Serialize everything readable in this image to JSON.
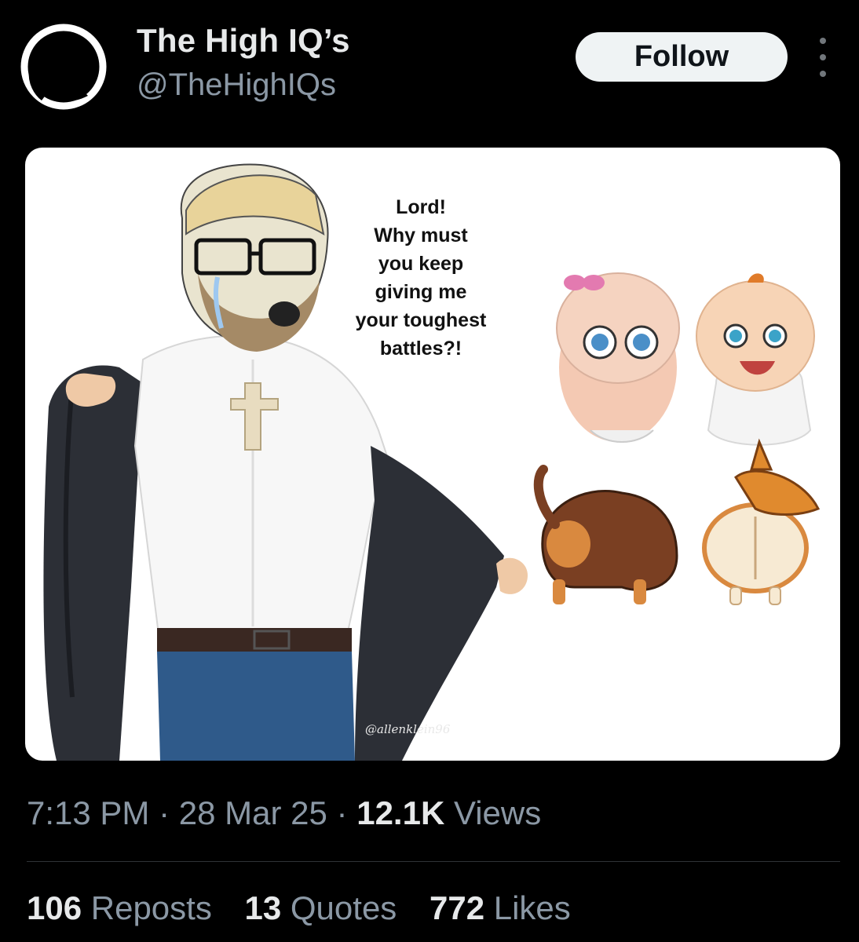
{
  "account": {
    "display_name": "The High IQ’s",
    "handle": "@TheHighIQs",
    "avatar_icon": "black-silhouette-avatar"
  },
  "actions": {
    "follow_label": "Follow",
    "more_icon": "vertical-ellipsis-icon"
  },
  "media": {
    "speech_text": "Lord!\nWhy must\nyou keep\ngiving me\nyour toughest\nbattles?!",
    "speech_lines": [
      "Lord!",
      "Why must",
      "you keep",
      "giving me",
      "your toughest",
      "battles?!"
    ],
    "watermark": "@allenklein96",
    "figures": [
      "bearded-man-crying-opening-jacket",
      "baby-girl-with-bow",
      "baby-boy",
      "dachshund-from-behind",
      "corgi-from-behind"
    ]
  },
  "meta": {
    "time": "7:13 PM",
    "separator": "·",
    "date": "28 Mar 25",
    "views_count": "12.1K",
    "views_label": "Views"
  },
  "stats": {
    "reposts_count": "106",
    "reposts_label": "Reposts",
    "quotes_count": "13",
    "quotes_label": "Quotes",
    "likes_count": "772",
    "likes_label": "Likes"
  },
  "colors": {
    "background": "#000000",
    "primary_text": "#e7e9ea",
    "secondary_text": "#8b98a5",
    "follow_bg": "#eff3f4"
  }
}
